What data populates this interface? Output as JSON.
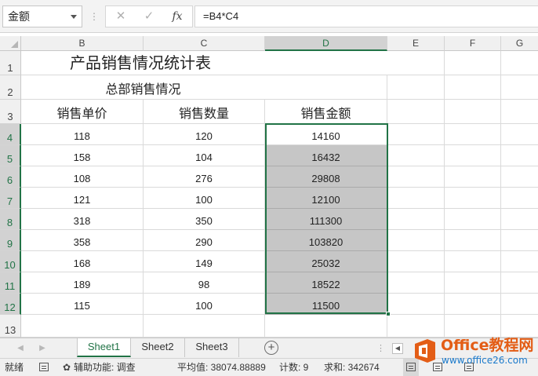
{
  "formula_bar": {
    "name_box": "金额",
    "separator": "⋮",
    "cancel": "✕",
    "enter": "✓",
    "fx": "fx",
    "formula": "=B4*C4"
  },
  "columns": [
    "B",
    "C",
    "D",
    "E",
    "F",
    "G"
  ],
  "rows": [
    "1",
    "2",
    "3",
    "4",
    "5",
    "6",
    "7",
    "8",
    "9",
    "10",
    "11",
    "12",
    "13"
  ],
  "sheet_cells": {
    "title": "产品销售情况统计表",
    "subtitle": "总部销售情况",
    "headers": [
      "销售单价",
      "销售数量",
      "销售金额"
    ],
    "data": [
      [
        "118",
        "120",
        "14160"
      ],
      [
        "158",
        "104",
        "16432"
      ],
      [
        "108",
        "276",
        "29808"
      ],
      [
        "121",
        "100",
        "12100"
      ],
      [
        "318",
        "350",
        "111300"
      ],
      [
        "358",
        "290",
        "103820"
      ],
      [
        "168",
        "149",
        "25032"
      ],
      [
        "189",
        "98",
        "18522"
      ],
      [
        "115",
        "100",
        "11500"
      ]
    ]
  },
  "tabs": {
    "nav_prev": "◀",
    "nav_next": "▶",
    "sheets": [
      "Sheet1",
      "Sheet2",
      "Sheet3"
    ],
    "active": "Sheet1",
    "add": "+",
    "more": "⋮",
    "scroll_left": "◀"
  },
  "status": {
    "ready": "就绪",
    "accessibility": "辅助功能: 调查",
    "average": "平均值: 38074.88889",
    "count": "计数: 9",
    "sum": "求和: 342674"
  },
  "watermark": {
    "brand": "Office教程网",
    "url": "www.office26.com"
  },
  "colors": {
    "accent": "#217346",
    "selection_fill": "#c6c6c6",
    "watermark_orange": "#e35d16",
    "watermark_blue": "#1b7acb"
  }
}
